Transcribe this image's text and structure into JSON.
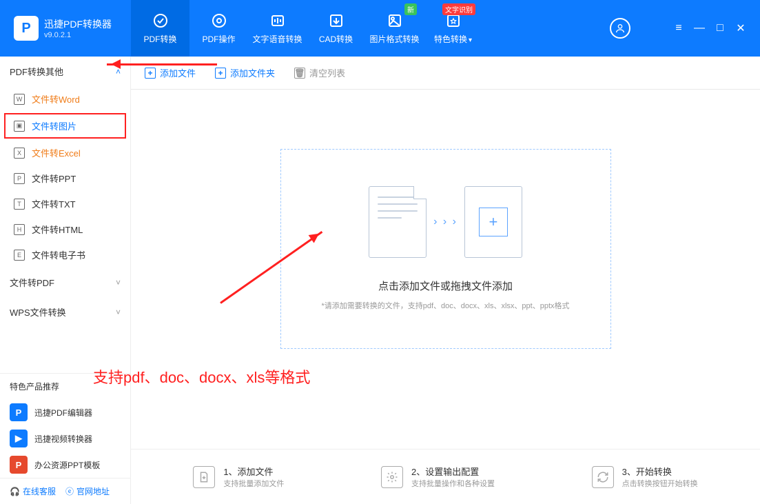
{
  "app": {
    "title": "迅捷PDF转换器",
    "version": "v9.0.2.1"
  },
  "tabs": [
    {
      "label": "PDF转换",
      "badge": null
    },
    {
      "label": "PDF操作",
      "badge": null
    },
    {
      "label": "文字语音转换",
      "badge": null
    },
    {
      "label": "CAD转换",
      "badge": null
    },
    {
      "label": "图片格式转换",
      "badge": "新"
    },
    {
      "label": "特色转换",
      "badge": "文字识别",
      "dropdown": true
    }
  ],
  "sidebar": {
    "section1": {
      "title": "PDF转换其他",
      "expanded": true
    },
    "items": [
      {
        "label": "文件转Word",
        "style": "orange"
      },
      {
        "label": "文件转图片",
        "style": "blue",
        "highlight": true
      },
      {
        "label": "文件转Excel",
        "style": "orange"
      },
      {
        "label": "文件转PPT",
        "style": ""
      },
      {
        "label": "文件转TXT",
        "style": ""
      },
      {
        "label": "文件转HTML",
        "style": ""
      },
      {
        "label": "文件转电子书",
        "style": ""
      }
    ],
    "section2": {
      "title": "文件转PDF",
      "expanded": false
    },
    "section3": {
      "title": "WPS文件转换",
      "expanded": false
    },
    "recommendTitle": "特色产品推荐",
    "recommends": [
      {
        "label": "迅捷PDF编辑器"
      },
      {
        "label": "迅捷视频转换器"
      },
      {
        "label": "办公资源PPT模板"
      }
    ],
    "links": {
      "service": "在线客服",
      "site": "官网地址"
    }
  },
  "toolbar": {
    "addFile": "添加文件",
    "addFolder": "添加文件夹",
    "clearList": "清空列表"
  },
  "dropzone": {
    "title": "点击添加文件或拖拽文件添加",
    "hint": "*请添加需要转换的文件，支持pdf、doc、docx、xls、xlsx、ppt、pptx格式"
  },
  "annotation": {
    "text": "支持pdf、doc、docx、xls等格式"
  },
  "steps": [
    {
      "title": "1、添加文件",
      "sub": "支持批量添加文件"
    },
    {
      "title": "2、设置输出配置",
      "sub": "支持批量操作和各种设置"
    },
    {
      "title": "3、开始转换",
      "sub": "点击转换按钮开始转换"
    }
  ]
}
